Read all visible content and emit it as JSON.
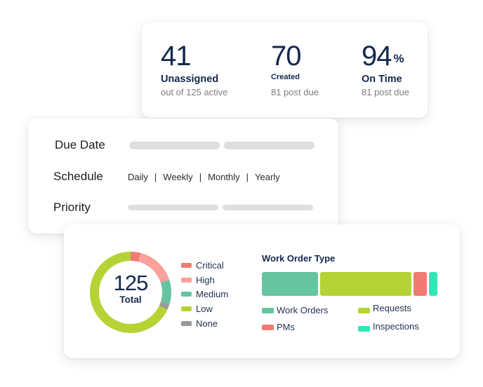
{
  "stats": [
    {
      "value": "41",
      "suffix": "",
      "label": "Unassigned",
      "sub": "out of 125 active"
    },
    {
      "value": "70",
      "suffix": "",
      "label": "Created",
      "sub": "81 post due"
    },
    {
      "value": "94",
      "suffix": "%",
      "label": "On Time",
      "sub": "81 post due"
    }
  ],
  "filters": {
    "due_date_label": "Due Date",
    "schedule_label": "Schedule",
    "priority_label": "Priority",
    "schedule_options": [
      "Daily",
      "Weekly",
      "Monthly",
      "Yearly"
    ],
    "separator": "|"
  },
  "chart_data": [
    {
      "type": "pie",
      "variant": "donut",
      "center_value": "125",
      "center_label": "Total",
      "categories": [
        "Critical",
        "High",
        "Medium",
        "None",
        "Low"
      ],
      "values": [
        5,
        20,
        12,
        3,
        85
      ],
      "colors": [
        "#f07b72",
        "#f9a19a",
        "#67c4a1",
        "#9a9a9a",
        "#b5d334"
      ],
      "legend": [
        "Critical",
        "High",
        "Medium",
        "Low",
        "None"
      ],
      "legend_colors": [
        "#f07b72",
        "#f9a19a",
        "#67c4a1",
        "#b5d334",
        "#9a9a9a"
      ],
      "legend_position": "right"
    },
    {
      "type": "bar",
      "variant": "stacked-horizontal",
      "title": "Work Order Type",
      "categories": [
        "Work Orders",
        "Requests",
        "PMs",
        "Inspections"
      ],
      "values": [
        33,
        54,
        8,
        5
      ],
      "unit": "percent",
      "colors": [
        "#67c4a1",
        "#b5d334",
        "#f07b72",
        "#2ee8b6"
      ],
      "legend": [
        "Work Orders",
        "Requests",
        "PMs",
        "Inspections"
      ],
      "legend_position": "bottom"
    }
  ]
}
